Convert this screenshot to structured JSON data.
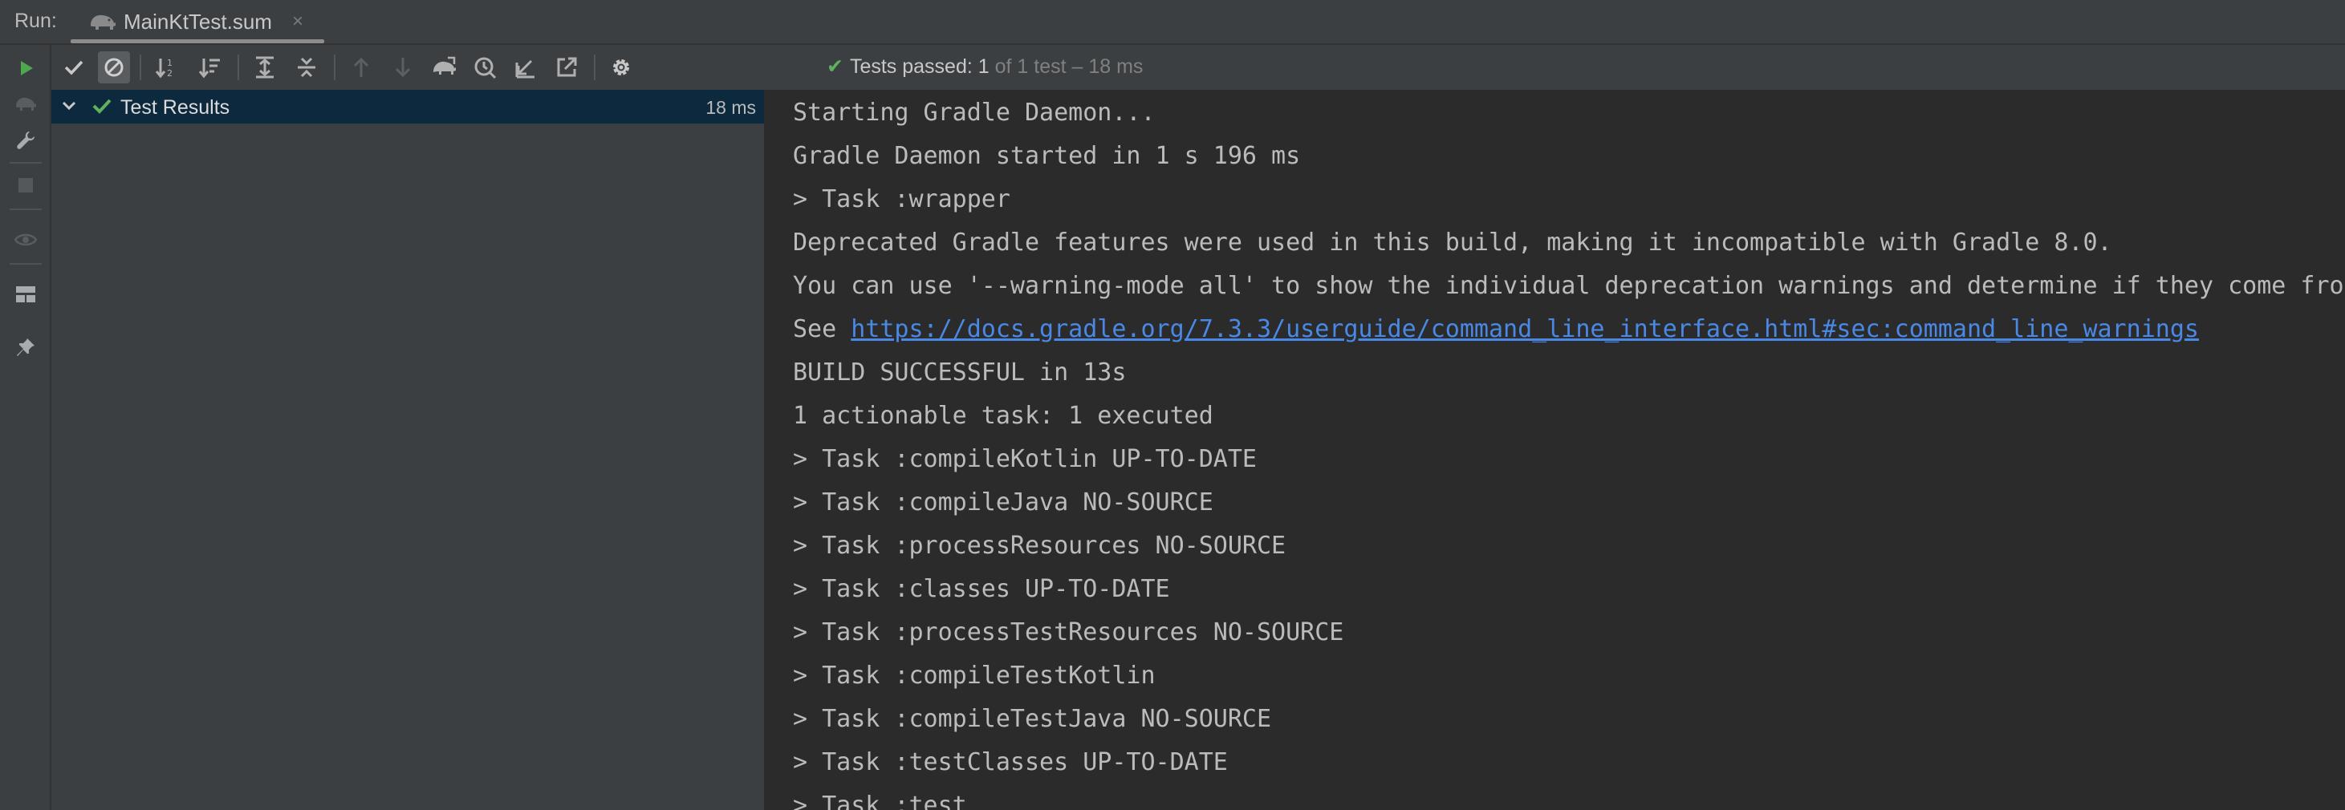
{
  "tabbar": {
    "run_label": "Run:",
    "tab_label": "MainKtTest.sum",
    "tab_close": "×",
    "tab_icon": "gradle-elephant-icon"
  },
  "left_strip": {
    "icons": [
      "rerun-icon",
      "rerun-failed-icon",
      "wrench-icon",
      "stop-icon",
      "eye-icon",
      "layout-icon",
      "pin-icon"
    ]
  },
  "toolbar": {
    "icons": [
      "show-passed-icon",
      "show-ignored-icon",
      "sort-alpha-icon",
      "sort-duration-icon",
      "expand-all-icon",
      "collapse-all-icon",
      "prev-failed-icon",
      "next-failed-icon",
      "import-tests-icon",
      "history-icon",
      "export-icon",
      "open-external-icon",
      "settings-gear-icon"
    ]
  },
  "status": {
    "main": "Tests passed: 1",
    "dim": " of 1 test – 18 ms",
    "color_pass": "#5fb15f"
  },
  "tree": {
    "root_label": "Test Results",
    "root_time": "18 ms",
    "selected_bg": "#0d293e"
  },
  "console": {
    "lines": [
      "Starting Gradle Daemon...",
      "Gradle Daemon started in 1 s 196 ms",
      "> Task :wrapper",
      "Deprecated Gradle features were used in this build, making it incompatible with Gradle 8.0.",
      "You can use '--warning-mode all' to show the individual deprecation warnings and determine if they come from your own scripts or plugins.",
      "",
      "BUILD SUCCESSFUL in 13s",
      "1 actionable task: 1 executed",
      "> Task :compileKotlin UP-TO-DATE",
      "> Task :compileJava NO-SOURCE",
      "> Task :processResources NO-SOURCE",
      "> Task :classes UP-TO-DATE",
      "> Task :processTestResources NO-SOURCE",
      "> Task :compileTestKotlin",
      "> Task :compileTestJava NO-SOURCE",
      "> Task :testClasses UP-TO-DATE",
      "> Task :test"
    ],
    "see_prefix": "See ",
    "see_link": "https://docs.gradle.org/7.3.3/userguide/command_line_interface.html#sec:command_line_warnings",
    "link_color": "#4a88e6"
  }
}
